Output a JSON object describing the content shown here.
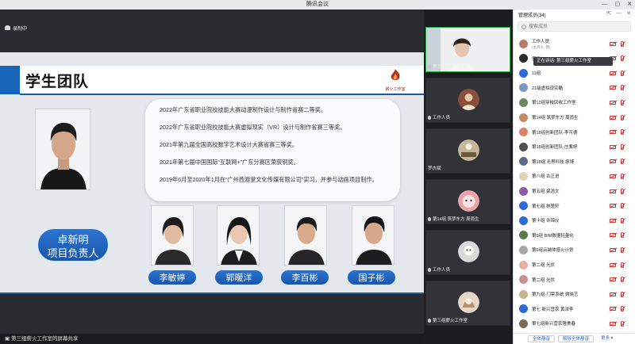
{
  "window": {
    "title": "腾讯会议"
  },
  "recording": {
    "label": "录制中"
  },
  "slide": {
    "title": "学生团队",
    "logo_text": "薪火工作室",
    "leader": {
      "name": "卓新明",
      "role": "项目负责人"
    },
    "awards": [
      "2022年广东省职业院校技能大赛动漫制作设计与制作省赛二等奖。",
      "2022年广东省职业院校技能大赛虚拟现实（VR）设计与制作省赛三等奖。",
      "2021年第九届全国高校数字艺术设计大赛省赛三等奖。",
      "2021年第七届中国国际“互联网+”广东分赛区荣获铜奖。",
      "2019年6月至2020年1月在“广州西游堂文化传媒有限公司”实习，并参与动画项目制作。"
    ],
    "members": [
      "李敏婷",
      "郭暖洋",
      "李百彬",
      "国子彬"
    ]
  },
  "share_status": "第三组薪火工作室的屏幕共享",
  "video_tiles": [
    {
      "label": "第三组薪火工作室",
      "color": "#d8c9b8"
    },
    {
      "label": "工作人员",
      "color": "#8a4f3a"
    },
    {
      "label": "罗杰斌",
      "color": "#c7b79a"
    },
    {
      "label": "第14组 筑梦东方 周雨生",
      "color": "#e8a3a8"
    },
    {
      "label": "工作人员",
      "color": "#d9d9d9"
    },
    {
      "label": "第三组薪火工作室",
      "color": "#e7d7c7"
    }
  ],
  "panel": {
    "title": "管理成员(34)",
    "search_placeholder": "搜索成员",
    "tooltip": "正在讲话: 第三组薪火工作室",
    "members": [
      {
        "name": "工作人员",
        "sub": "(主持人, 我)",
        "color": "#b67c6a"
      },
      {
        "name": "第三...",
        "sub": "",
        "color": "#2b2b2b"
      },
      {
        "name": "11组",
        "sub": "",
        "color": "#2d6ad6"
      },
      {
        "name": "21级虚拟现实酷",
        "sub": "",
        "color": "#7a9bbf"
      },
      {
        "name": "第12组穿梭回收工作室",
        "sub": "",
        "color": "#6e8a5c"
      },
      {
        "name": "第14组 筑梦东方 周雨生",
        "sub": "",
        "color": "#c38a6b"
      },
      {
        "name": "第18组创新团队-李可德",
        "sub": "",
        "color": "#d9836a"
      },
      {
        "name": "第18组创新团队-庄紫婷",
        "sub": "",
        "color": "#4f4f4f"
      },
      {
        "name": "第18组 无界科技 廖博",
        "sub": "",
        "color": "#5b6c8a"
      },
      {
        "name": "第八组 古正进",
        "sub": "",
        "color": "#e0d2b8"
      },
      {
        "name": "第五组 梁浩文",
        "sub": "",
        "color": "#8f5aa6"
      },
      {
        "name": "第七组 林楚轩",
        "sub": "",
        "color": "#2d6ad6"
      },
      {
        "name": "第十组 许锦仪",
        "sub": "",
        "color": "#2d6ad6"
      },
      {
        "name": "第5组 BIM数据轻量化",
        "sub": "",
        "color": "#5a7a4a"
      },
      {
        "name": "第6组云端体感火计划",
        "sub": "",
        "color": "#a7a7a7"
      },
      {
        "name": "第二组 光伏",
        "sub": "",
        "color": "#e6b0a0"
      },
      {
        "name": "第二组 光伏",
        "sub": "",
        "color": "#c78f8f"
      },
      {
        "name": "第九组-门禁系统 谢晓艺",
        "sub": "",
        "color": "#c8b58e"
      },
      {
        "name": "第七 新兴营农 黄泽李",
        "sub": "",
        "color": "#2d6ad6"
      },
      {
        "name": "第七组新兴营农隆美春",
        "sub": "",
        "color": "#7b6a55"
      }
    ],
    "footer": {
      "mute_all": "全体静音",
      "unmute_all": "解除全体静音",
      "more": "更多 ▾"
    }
  }
}
